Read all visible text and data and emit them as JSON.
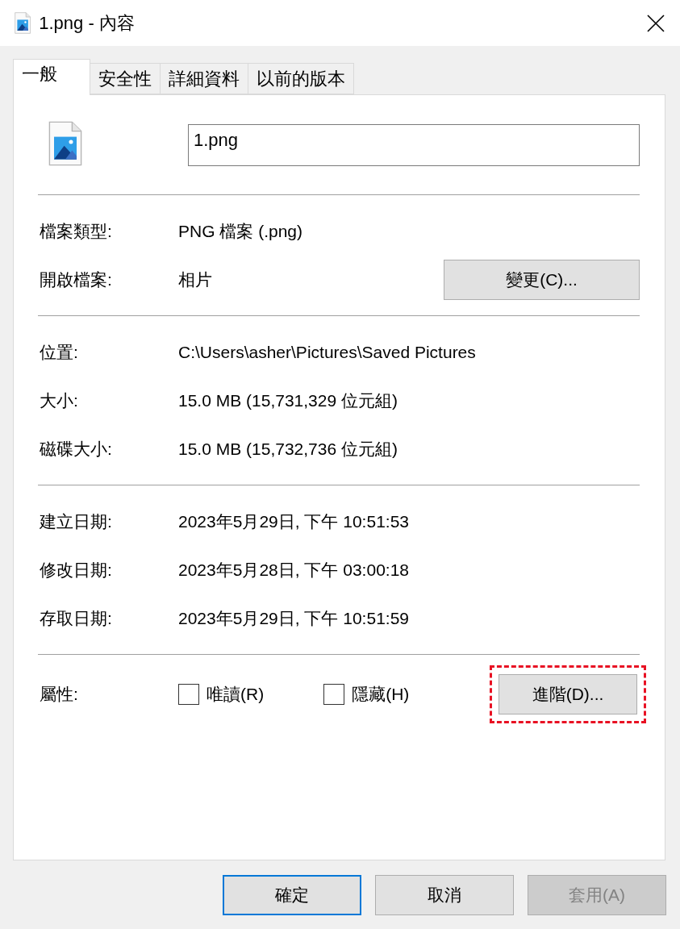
{
  "window": {
    "title": "1.png - 內容"
  },
  "tabs": [
    {
      "label": "一般",
      "selected": true
    },
    {
      "label": "安全性",
      "selected": false
    },
    {
      "label": "詳細資料",
      "selected": false
    },
    {
      "label": "以前的版本",
      "selected": false
    }
  ],
  "file_name": {
    "value": "1.png"
  },
  "sections": [
    {
      "rows": [
        {
          "label": "檔案類型:",
          "value": "PNG 檔案 (.png)"
        },
        {
          "label": "開啟檔案:",
          "value": "相片",
          "button": "變更(C)..."
        }
      ]
    },
    {
      "rows": [
        {
          "label": "位置:",
          "value": "C:\\Users\\asher\\Pictures\\Saved Pictures"
        },
        {
          "label": "大小:",
          "value": "15.0 MB (15,731,329 位元組)"
        },
        {
          "label": "磁碟大小:",
          "value": "15.0 MB (15,732,736 位元組)"
        }
      ]
    },
    {
      "rows": [
        {
          "label": "建立日期:",
          "value": "2023年5月29日, 下午 10:51:53"
        },
        {
          "label": "修改日期:",
          "value": "2023年5月28日, 下午 03:00:18"
        },
        {
          "label": "存取日期:",
          "value": "2023年5月29日, 下午 10:51:59"
        }
      ]
    }
  ],
  "attributes": {
    "label": "屬性:",
    "checkboxes": [
      {
        "label": "唯讀(R)",
        "checked": false
      },
      {
        "label": "隱藏(H)",
        "checked": false
      }
    ],
    "advanced_button": {
      "label": "進階(D)...",
      "highlighted": true
    }
  },
  "buttons": [
    {
      "label": "確定",
      "default": true,
      "disabled": false
    },
    {
      "label": "取消",
      "default": false,
      "disabled": false
    },
    {
      "label": "套用(A)",
      "default": false,
      "disabled": true
    }
  ]
}
